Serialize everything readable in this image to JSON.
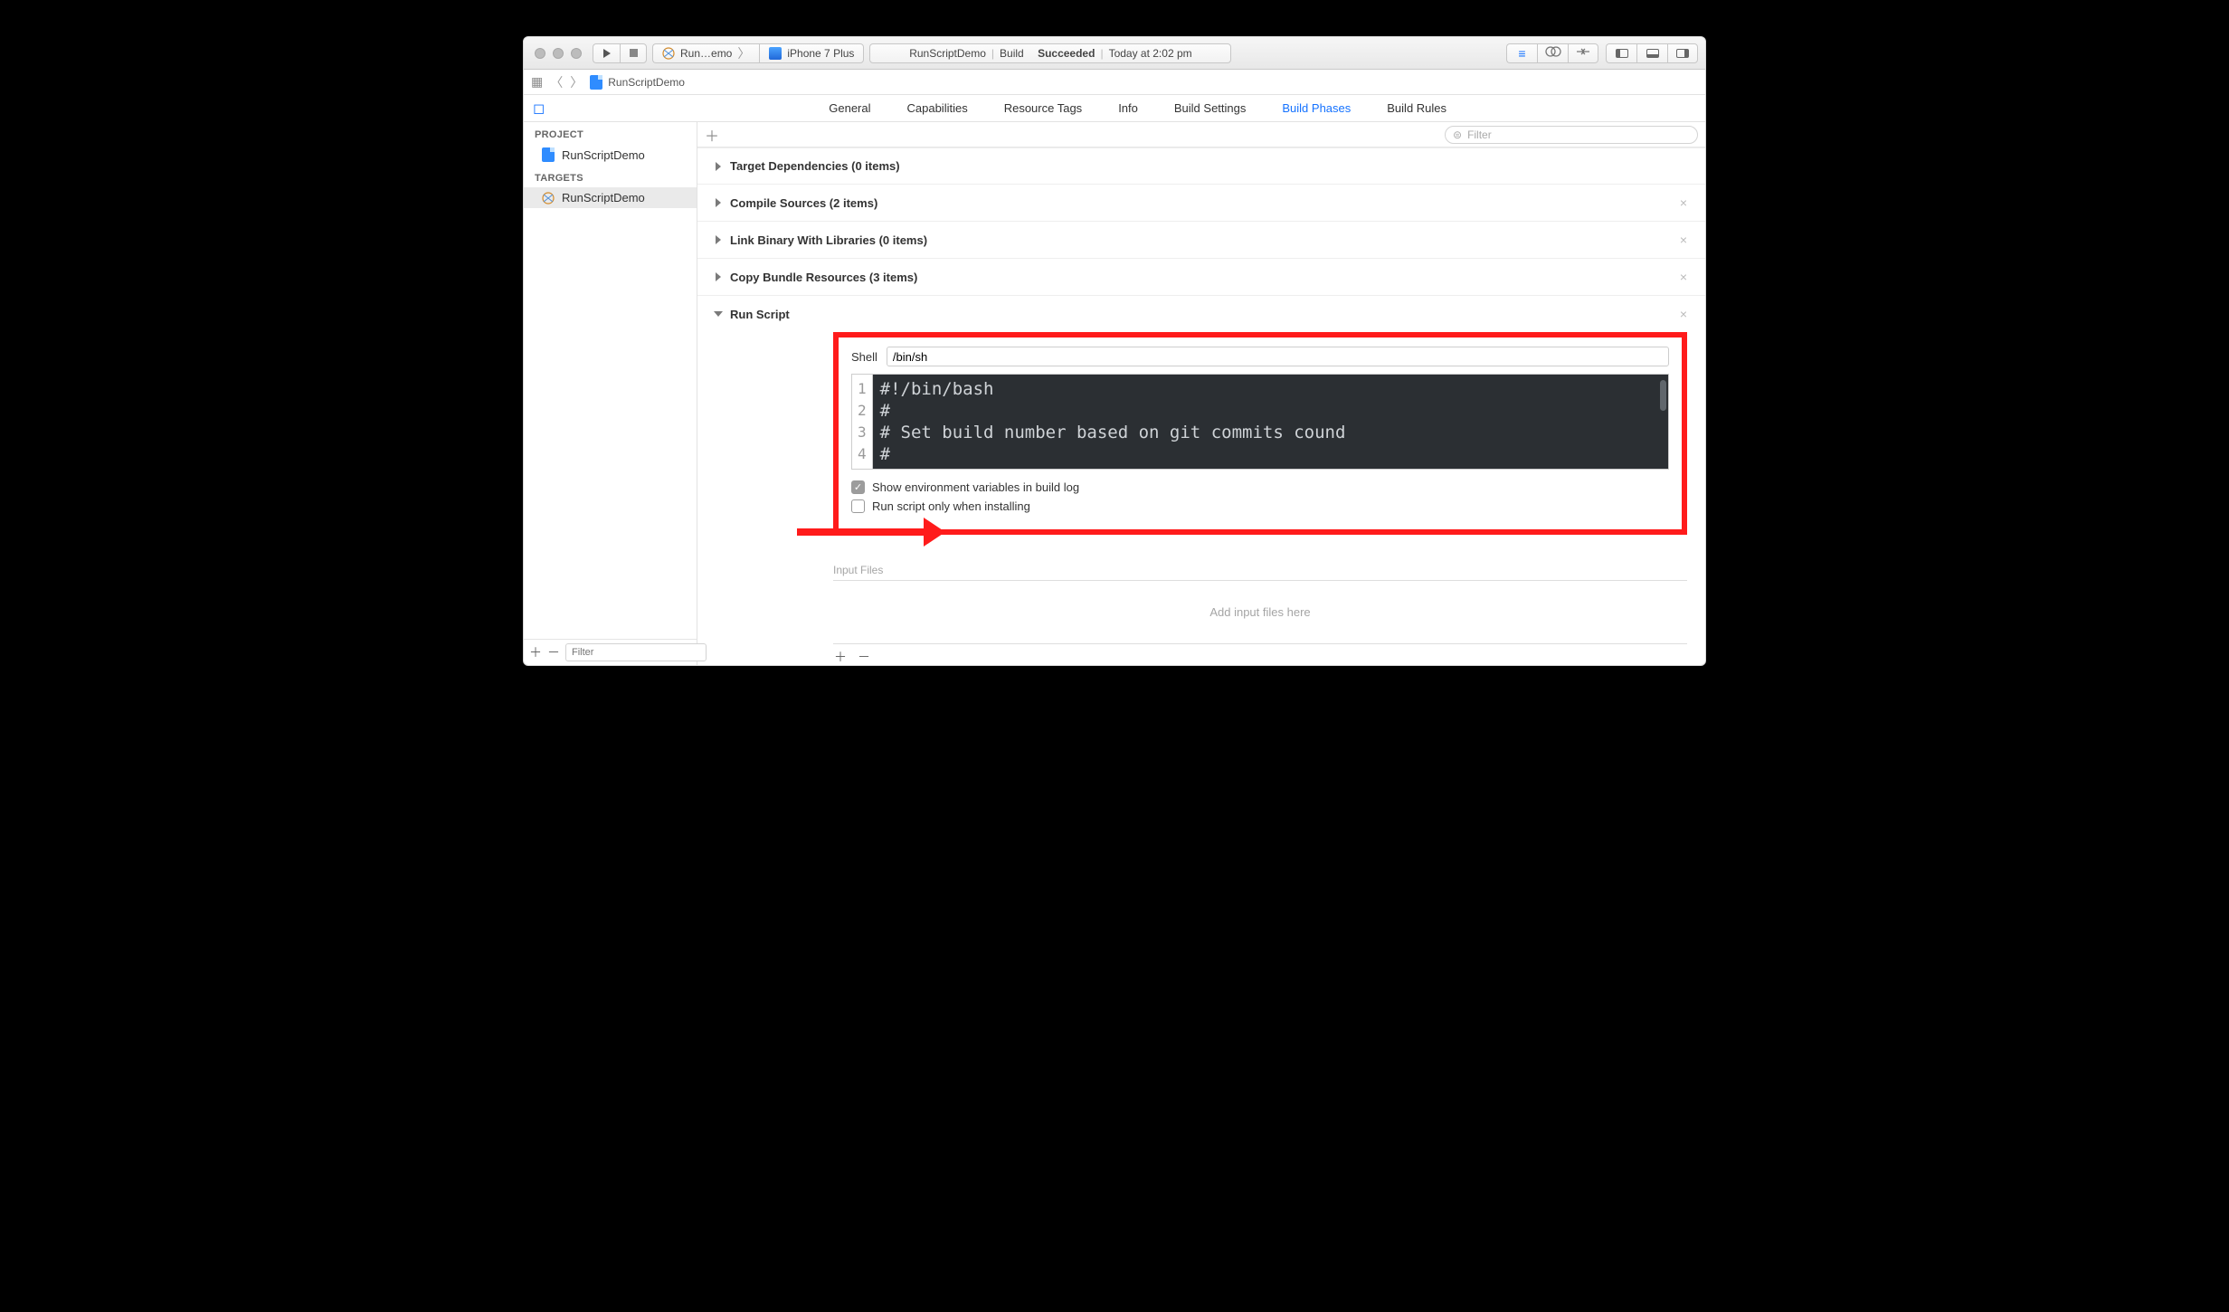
{
  "toolbar": {
    "scheme_name": "Run…emo",
    "device_name": "iPhone 7 Plus"
  },
  "activity": {
    "project": "RunScriptDemo",
    "prefix": "Build",
    "status_word": "Succeeded",
    "timestamp": "Today at 2:02 pm"
  },
  "breadcrumb": {
    "file": "RunScriptDemo"
  },
  "tabs": {
    "general": "General",
    "capabilities": "Capabilities",
    "resource_tags": "Resource Tags",
    "info": "Info",
    "build_settings": "Build Settings",
    "build_phases": "Build Phases",
    "build_rules": "Build Rules"
  },
  "sidebar": {
    "project_label": "PROJECT",
    "project_name": "RunScriptDemo",
    "targets_label": "TARGETS",
    "target_name": "RunScriptDemo",
    "filter_placeholder": "Filter"
  },
  "content_filter_placeholder": "Filter",
  "phases": {
    "target_deps": "Target Dependencies (0 items)",
    "compile_sources": "Compile Sources (2 items)",
    "link_binary": "Link Binary With Libraries (0 items)",
    "copy_bundle": "Copy Bundle Resources (3 items)",
    "run_script": "Run Script"
  },
  "runscript": {
    "shell_label": "Shell",
    "shell_value": "/bin/sh",
    "code": {
      "l1": "#!/bin/bash",
      "l2": "#",
      "l3": "# Set build number based on git commits cound",
      "l4": "#"
    },
    "chk_show_env": "Show environment variables in build log",
    "chk_only_install": "Run script only when installing",
    "input_files_header": "Input Files",
    "input_files_placeholder": "Add input files here"
  }
}
